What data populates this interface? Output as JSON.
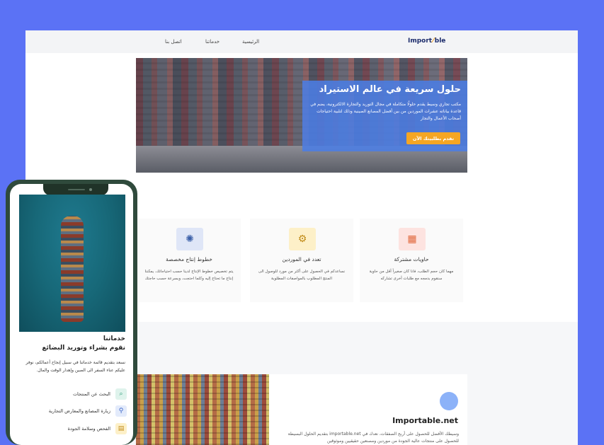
{
  "header": {
    "logo_left": "Import",
    "logo_right": "ble",
    "nav": [
      "الرئيسية",
      "خدماتنا",
      "اتصل بنا"
    ]
  },
  "hero": {
    "title": "حلول سريعة في عالم الاستيراد",
    "description": "مكتب تجاري وسيط يقدم حلولًا متكاملة في مجال التوريد والتجارة الالكترونية، يضم في قاعدة بياناته عشرات الموردين من بين أفضل المصانع الصينية وذلك لتلبية احتياجات أصحاب الأعمال والتجار",
    "button": "تقدم بطلبيتك الآن"
  },
  "features": [
    {
      "title": "حاويات مشتركة",
      "text": "مهما كان حجم الطلب، فانا كان صغيراً أقل من حاوية سنقوم بدمجه مع طلبات أخرى تشاركه",
      "icon": "container-icon",
      "icon_bg": "#fde3e0"
    },
    {
      "title": "تعدد في الموردين",
      "text": "نساعدكم في الحصول على أكثر من مورد للوصول الى المنتج المطلوب بالمواصفات المطلوبة",
      "icon": "gears-icon",
      "icon_bg": "#fdf0c8"
    },
    {
      "title": "خطوط إنتاج مخصصة",
      "text": "يتم تخصيص خطوط الإنتاج لدينا حسب احتياجاتك، يمكننا إنتاج ما تحتاج إليه وكلما احتجت، وبسرعة حسب حاجتك",
      "icon": "production-icon",
      "icon_bg": "#dfe6f7"
    }
  ],
  "about": {
    "title": "Importable.net",
    "text": "وسيطك الأفضل للحصول على أربح الصفقات، نعدك في importable.net بتقديم الحلول البسيطة للحصول على منتجات عالية الجودة من موردين ومصنعين حقيقيين وموثوقين"
  },
  "mobile": {
    "section_title": "خدماتنا",
    "subtitle": "نقوم بشراء وتوريد البضائع",
    "text": "نسعد بتقديم قائمة خدماتنا في سبيل إنجاح أعمالكم، نوفر عليكم عناء السفر الى الصين وإهدار الوقت والمال.",
    "services": [
      {
        "label": "البحث عن المنتجات",
        "icon": "search-icon",
        "color": "#dff3ec"
      },
      {
        "label": "زيارة المصانع والمعارض التجارية",
        "icon": "factory-icon",
        "color": "#e3ebfb"
      },
      {
        "label": "الفحص وسلامة الجودة",
        "icon": "quality-icon",
        "color": "#fdf0c8"
      }
    ]
  },
  "colors": {
    "background": "#5b72f5",
    "hero_box": "#4b7de4",
    "accent": "#f5a623"
  }
}
